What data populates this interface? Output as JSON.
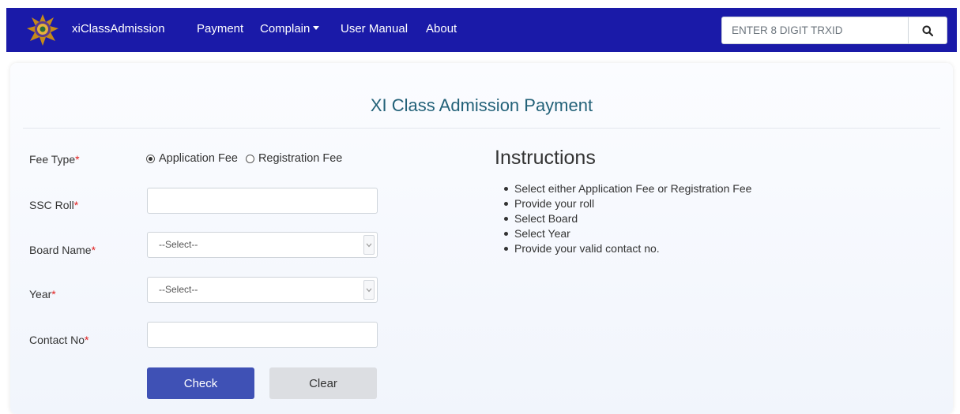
{
  "navbar": {
    "brand": "xiClassAdmission",
    "links": [
      "Payment",
      "Complain",
      "User Manual",
      "About"
    ],
    "search_placeholder": "ENTER 8 DIGIT TRXID",
    "search_icon": "search-icon"
  },
  "form": {
    "title": "XI Class Admission Payment",
    "fee_type_label": "Fee Type",
    "fee_options": [
      "Application Fee",
      "Registration Fee"
    ],
    "fee_selected": "Application Fee",
    "ssc_roll_label": "SSC Roll",
    "ssc_roll_value": "",
    "board_label": "Board Name",
    "board_value": "--Select--",
    "year_label": "Year",
    "year_value": "--Select--",
    "contact_label": "Contact No",
    "contact_value": "",
    "required_mark": "*",
    "check_label": "Check",
    "clear_label": "Clear"
  },
  "instructions": {
    "title": "Instructions",
    "items": [
      "Select either Application Fee or Registration Fee",
      "Provide your roll",
      "Select Board",
      "Select Year",
      "Provide your valid contact no."
    ]
  },
  "colors": {
    "navbar_bg": "#1a1aa8",
    "title": "#226178",
    "primary_button": "#3f51b5",
    "secondary_button": "#dcdee2",
    "required": "#e02020"
  }
}
